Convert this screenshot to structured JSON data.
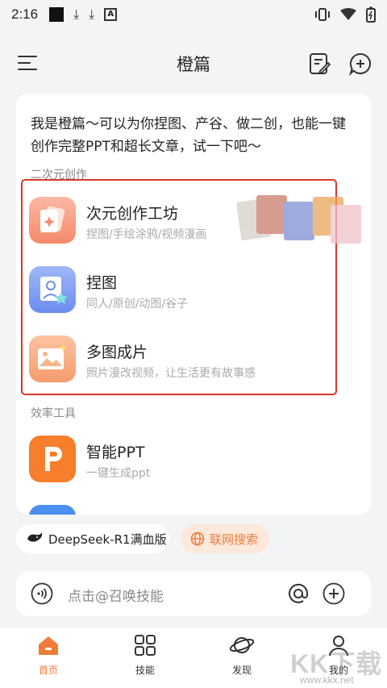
{
  "status_bar": {
    "time": "2:16"
  },
  "header": {
    "title": "橙篇"
  },
  "intro": {
    "text": "我是橙篇～可以为你捏图、产谷、做二创，也能一键创作完整PPT和超长文章，试一下吧～"
  },
  "sections": {
    "creation_label": "二次元创作",
    "efficiency_label": "效率工具"
  },
  "creation_items": [
    {
      "name": "次元创作工坊",
      "desc": "捏图/手绘涂鸦/视频漫画"
    },
    {
      "name": "捏图",
      "desc": "同人/原创/动图/谷子"
    },
    {
      "name": "多图成片",
      "desc": "照片漫改视频，让生活更有故事感"
    }
  ],
  "efficiency_items": [
    {
      "name": "智能PPT",
      "desc": "一键生成ppt"
    }
  ],
  "chips": {
    "model": "DeepSeek-R1满血版",
    "web_search": "联网搜索"
  },
  "input": {
    "placeholder": "点击@召唤技能"
  },
  "tabs": [
    {
      "label": "首页",
      "active": true
    },
    {
      "label": "技能"
    },
    {
      "label": "发现"
    },
    {
      "label": "我的"
    }
  ],
  "watermark": {
    "text": "KK下载",
    "url": "www.kkx.net"
  },
  "colors": {
    "accent": "#f07c3a",
    "highlight_border": "#d9372b",
    "ppt_icon": "#f77f2c"
  }
}
